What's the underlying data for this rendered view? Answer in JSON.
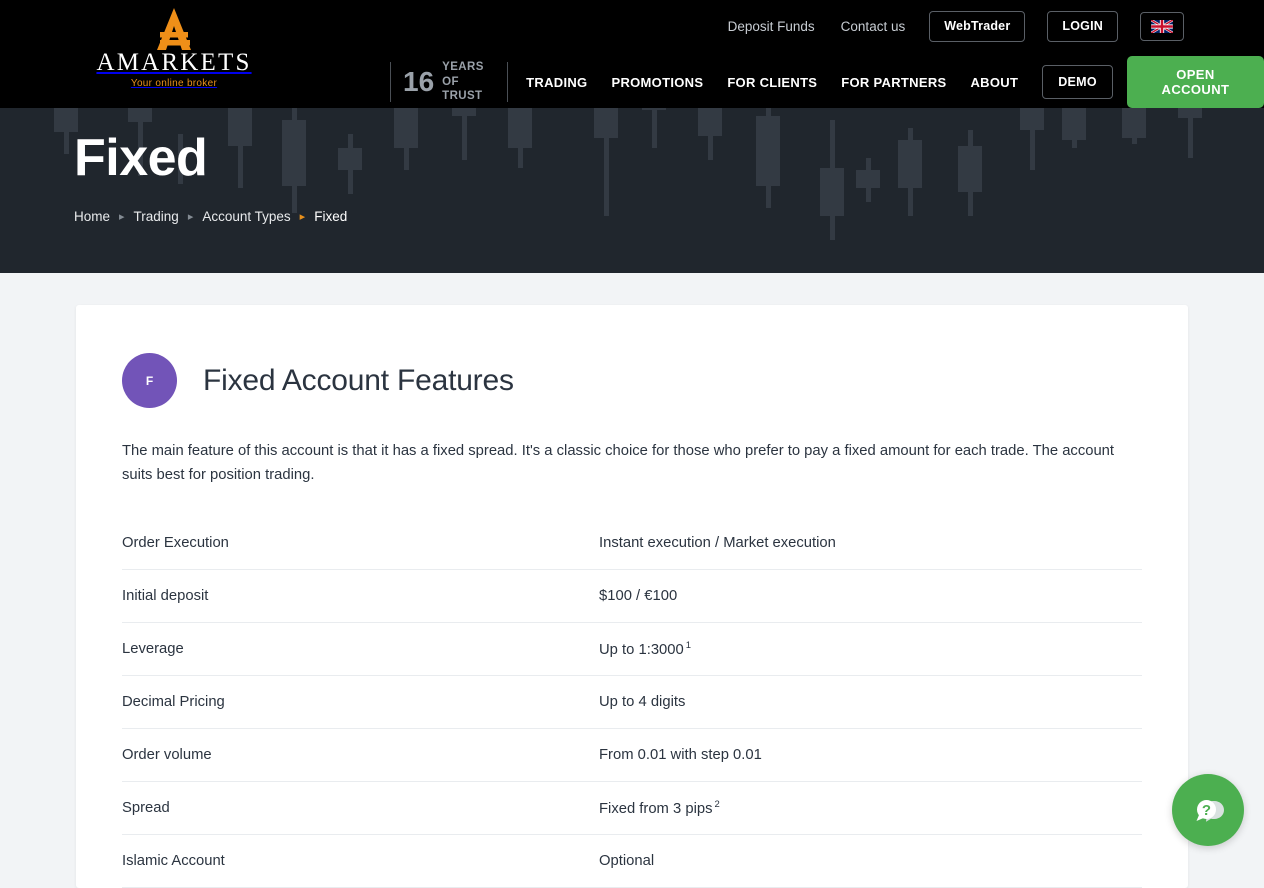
{
  "brand": {
    "name": "AMARKETS",
    "tagline": "Your online broker",
    "logo_icon": "amarkets-a-logo",
    "accent_orange": "#e8901c",
    "accent_green": "#4caf50",
    "banner_bg": "#20262d"
  },
  "header": {
    "utility_links": [
      "Deposit Funds",
      "Contact us"
    ],
    "webtrader_label": "WebTrader",
    "login_label": "LOGIN",
    "flag_icon": "uk-flag-icon",
    "years_number": "16",
    "years_line1": "YEARS",
    "years_line2": "OF TRUST",
    "nav_items": [
      "TRADING",
      "PROMOTIONS",
      "FOR CLIENTS",
      "FOR PARTNERS",
      "ABOUT"
    ],
    "demo_label": "DEMO",
    "open_account_label": "OPEN ACCOUNT"
  },
  "hero": {
    "title": "Fixed",
    "breadcrumb": [
      {
        "label": "Home",
        "current": false
      },
      {
        "label": "Trading",
        "current": false
      },
      {
        "label": "Account Types",
        "current": false
      },
      {
        "label": "Fixed",
        "current": true
      }
    ]
  },
  "card": {
    "avatar_letter": "F",
    "avatar_color": "#7254b8",
    "title": "Fixed Account Features",
    "description": "The main feature of this account is that it has a fixed spread. It's a classic choice for those who prefer to pay a fixed amount for each trade. The account suits best for position trading.",
    "specs": [
      {
        "label": "Order Execution",
        "value": "Instant execution / Market execution",
        "note": ""
      },
      {
        "label": "Initial deposit",
        "value": "$100 / €100",
        "note": ""
      },
      {
        "label": "Leverage",
        "value": "Up to 1:3000",
        "note": "1"
      },
      {
        "label": "Decimal Pricing",
        "value": "Up to 4 digits",
        "note": ""
      },
      {
        "label": "Order volume",
        "value": "From 0.01 with step 0.01",
        "note": ""
      },
      {
        "label": "Spread",
        "value": "Fixed from 3 pips",
        "note": "2"
      },
      {
        "label": "Islamic Account",
        "value": "Optional",
        "note": ""
      }
    ]
  },
  "chat": {
    "icon": "question-chat-bubble-icon"
  }
}
